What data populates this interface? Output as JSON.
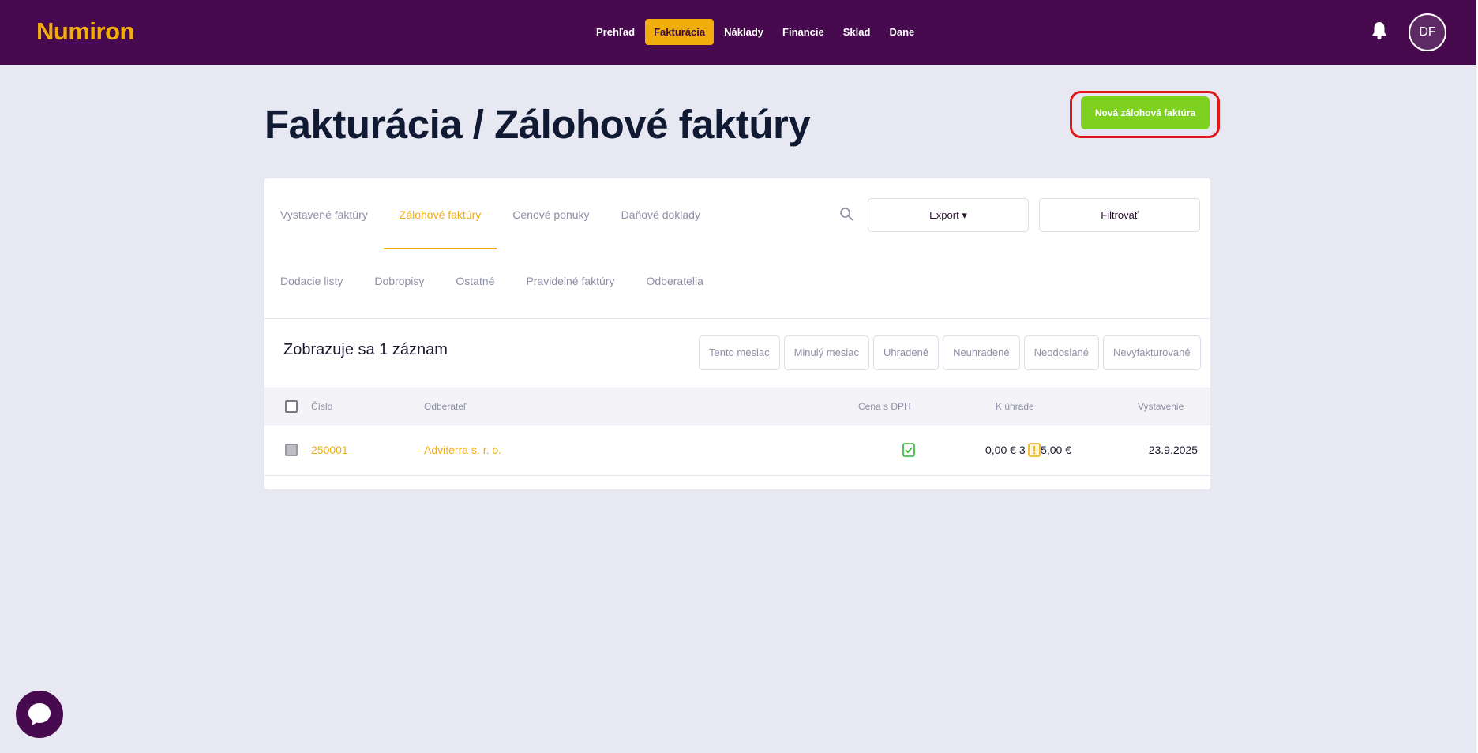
{
  "app": {
    "logo": "Numiron",
    "user_initials": "DF",
    "colors": {
      "brand": "#470a4e",
      "accent": "#f0ad0c",
      "primary_action": "#7fd11f"
    }
  },
  "nav": {
    "items": [
      {
        "label": "Prehľad"
      },
      {
        "label": "Fakturácia",
        "active": true
      },
      {
        "label": "Náklady"
      },
      {
        "label": "Financie"
      },
      {
        "label": "Sklad"
      },
      {
        "label": "Dane"
      }
    ]
  },
  "page": {
    "title": "Fakturácia / Zálohové faktúry",
    "new_button": "Nová zálohová faktúra"
  },
  "tabs": {
    "row1": [
      {
        "label": "Vystavené faktúry"
      },
      {
        "label": "Zálohové faktúry",
        "active": true
      },
      {
        "label": "Cenové ponuky"
      },
      {
        "label": "Daňové doklady"
      }
    ],
    "row2": [
      {
        "label": "Dodacie listy"
      },
      {
        "label": "Dobropisy"
      },
      {
        "label": "Ostatné"
      },
      {
        "label": "Pravidelné faktúry"
      },
      {
        "label": "Odberatelia"
      }
    ]
  },
  "toolbar": {
    "search_icon": "search-icon",
    "export_label": "Export ▾",
    "filter_label": "Filtrovať"
  },
  "list": {
    "count_text": "Zobrazuje sa 1 záznam",
    "filters": [
      "Tento mesiac",
      "Minulý mesiac",
      "Uhradené",
      "Neuhradené",
      "Neodoslané",
      "Nevyfakturované"
    ]
  },
  "table": {
    "headers": {
      "number": "Číslo",
      "customer": "Odberateľ",
      "price": "Cena s DPH",
      "due": "K úhrade",
      "issued": "Vystavenie"
    },
    "rows": [
      {
        "number": "250001",
        "customer": "Adviterra s. r. o.",
        "price": "3 075,00 €",
        "price_status_icon": "check-document-icon",
        "due": "0,00 €",
        "due_status_icon": "warning-document-icon",
        "issued": "23.9.2025"
      }
    ]
  }
}
